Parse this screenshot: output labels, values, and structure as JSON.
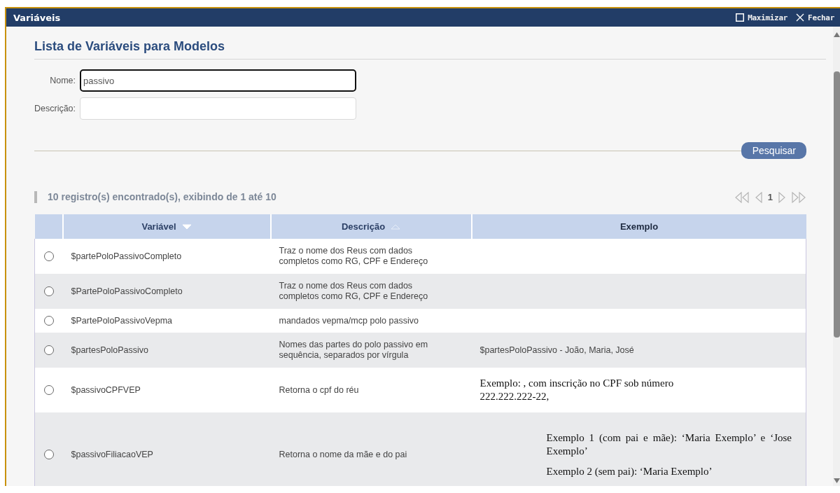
{
  "window": {
    "title": "Variáveis",
    "actions": [
      {
        "kind": "maximize",
        "label": "Maximizar"
      },
      {
        "kind": "close",
        "label": "Fechar"
      }
    ]
  },
  "heading": "Lista de Variáveis para Modelos",
  "form": {
    "fields": [
      {
        "label": "Nome:",
        "value": "passivo",
        "focused": true
      },
      {
        "label": "Descrição:",
        "focused": false
      }
    ],
    "search_button": "Pesquisar"
  },
  "results": {
    "summary": "10 registro(s) encontrado(s), exibindo de 1 até 10",
    "pagination": {
      "page": "1"
    }
  },
  "table": {
    "columns": [
      {
        "label": "Variável",
        "sortable": true,
        "sort_ascending": false,
        "sort_active": true
      },
      {
        "label": "Descrição",
        "sortable": true,
        "sort_ascending": true,
        "sort_active": false
      },
      {
        "label": "Exemplo",
        "sortable": false
      }
    ],
    "rows": [
      {
        "selected": false,
        "variable": "$partePoloPassivoCompleto",
        "description": "Traz o nome dos Reus com dados completos como RG, CPF e Endereço"
      },
      {
        "selected": false,
        "variable": "$PartePoloPassivoCompleto",
        "description": "Traz o nome dos Reus com dados completos como RG, CPF e Endereço"
      },
      {
        "selected": false,
        "variable": "$PartePoloPassivoVepma",
        "description": "mandados vepma/mcp polo passivo"
      },
      {
        "selected": false,
        "variable": "$partesPoloPassivo",
        "description": "Nomes das partes do polo passivo em sequência, separados por vírgula",
        "example": {
          "kind": "text",
          "paragraphs": [
            "$partesPoloPassivo - João, Maria, José"
          ]
        }
      },
      {
        "selected": false,
        "variable": "$passivoCPFVEP",
        "description": "Retorna o cpf do réu",
        "example": {
          "kind": "document",
          "paragraphs": [
            "Exemplo:  , com inscrição no CPF sob número 222.222.222-22,"
          ]
        }
      },
      {
        "selected": false,
        "variable": "$passivoFiliacaoVEP",
        "description": "Retorna o nome da mãe e do pai",
        "example": {
          "kind": "document-indented",
          "paragraphs": [
            "Exemplo 1 (com pai e mãe): ‘Maria Exemplo’ e ‘Jose Exemplo’",
            "Exemplo 2 (sem pai): ‘Maria Exemplo’"
          ]
        }
      }
    ]
  }
}
